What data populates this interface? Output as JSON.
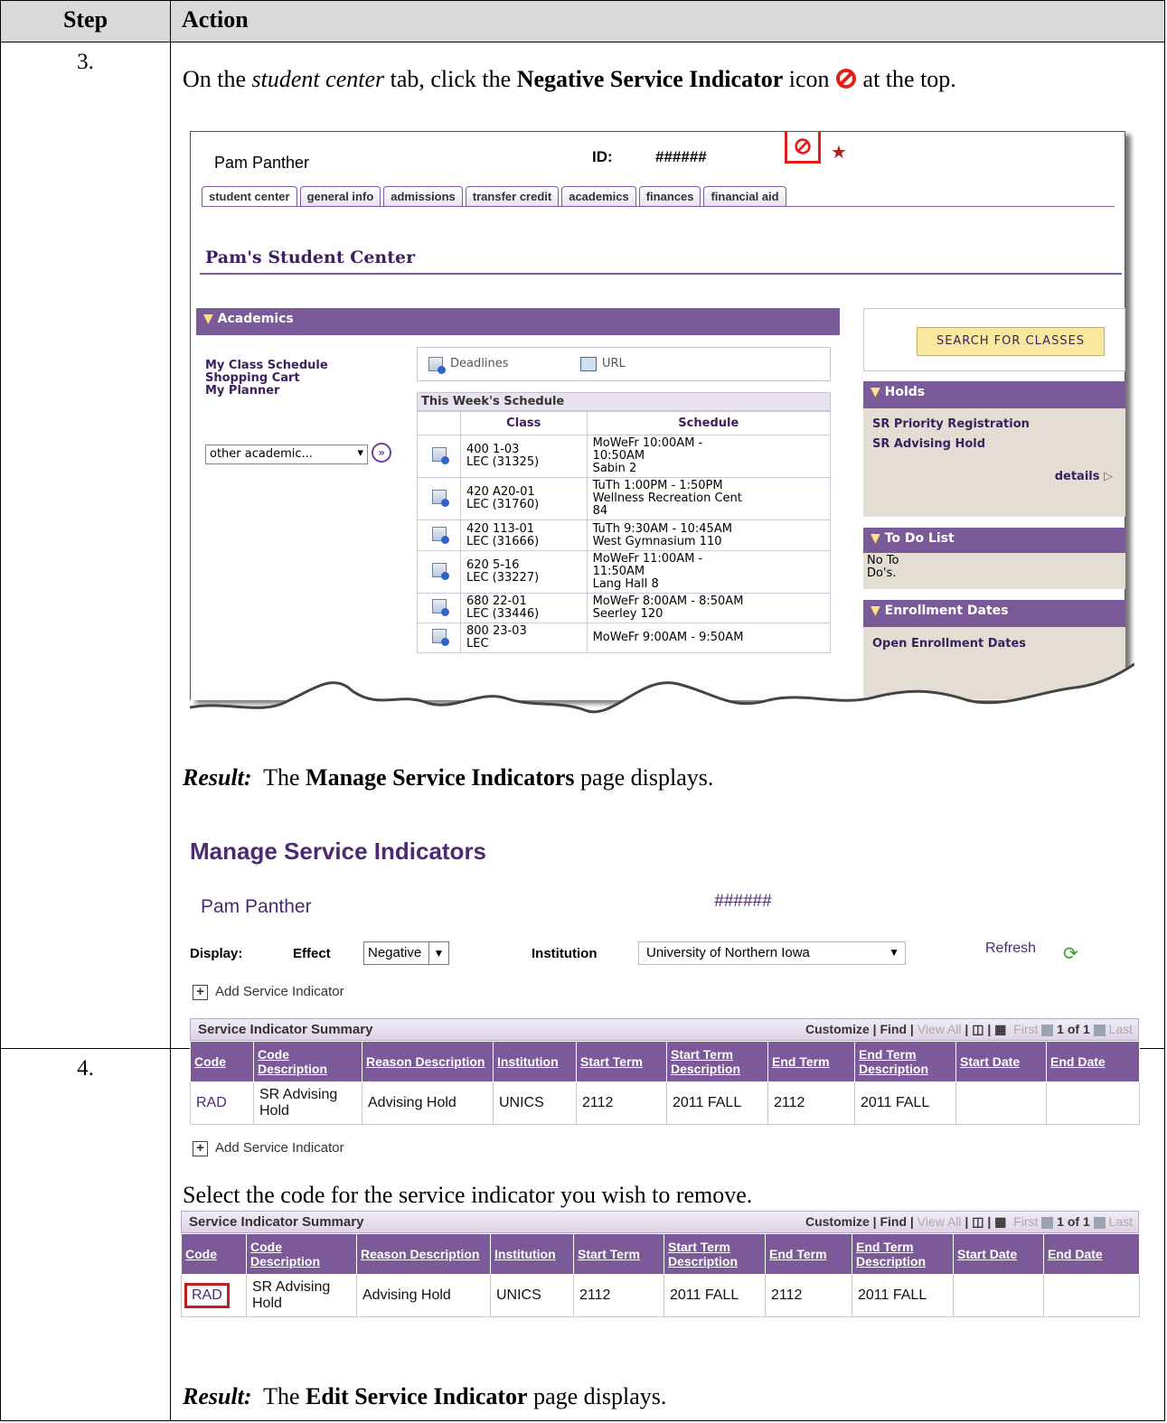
{
  "table": {
    "header_step": "Step",
    "header_action": "Action"
  },
  "step3": {
    "number": "3.",
    "instruction_1": "On the ",
    "instruction_italic": "student center",
    "instruction_2": " tab, click the ",
    "instruction_bold": "Negative Service Indicator",
    "instruction_3": " icon ",
    "instruction_4": " at the top.",
    "result_label": "Result:",
    "result_1": "  The ",
    "result_bold": "Manage Service Indicators",
    "result_2": " page displays."
  },
  "student_center": {
    "name": "Pam Panther",
    "id_label": "ID:",
    "id_value": "######",
    "tabs": [
      "student center",
      "general info",
      "admissions",
      "transfer credit",
      "academics",
      "finances",
      "financial aid"
    ],
    "page_title": "Pam's Student Center",
    "academics_header": "Academics",
    "links": [
      "My Class Schedule",
      "Shopping Cart",
      "My Planner"
    ],
    "other_academic": "other academic...",
    "deadlines": "Deadlines",
    "url": "URL",
    "schedule_title": "This Week's Schedule",
    "schedule_cols": [
      "Class",
      "Schedule"
    ],
    "schedule_rows": [
      {
        "class": "400 1-03\nLEC (31325)",
        "schedule": "MoWeFr 10:00AM -\n10:50AM\nSabin 2"
      },
      {
        "class": "420 A20-01\nLEC (31760)",
        "schedule": "TuTh 1:00PM - 1:50PM\nWellness Recreation Cent\n84"
      },
      {
        "class": "420 113-01\nLEC (31666)",
        "schedule": "TuTh 9:30AM - 10:45AM\nWest Gymnasium 110"
      },
      {
        "class": "620 5-16\nLEC (33227)",
        "schedule": "MoWeFr 11:00AM -\n11:50AM\nLang Hall 8"
      },
      {
        "class": "680 22-01\nLEC (33446)",
        "schedule": "MoWeFr 8:00AM - 8:50AM\nSeerley 120"
      },
      {
        "class": "800 23-03\nLEC",
        "schedule": "MoWeFr 9:00AM - 9:50AM"
      }
    ],
    "search_button": "SEARCH FOR CLASSES",
    "holds_header": "Holds",
    "holds": [
      "SR Priority Registration",
      "SR Advising Hold"
    ],
    "details": "details",
    "todo_header": "To Do List",
    "todo_text": "No To\nDo's.",
    "enroll_header": "Enrollment Dates",
    "enroll_link": "Open Enrollment Dates"
  },
  "manage": {
    "title": "Manage Service Indicators",
    "name": "Pam Panther",
    "id_value": "######",
    "display_label": "Display:",
    "effect_label": "Effect",
    "effect_value": "Negative",
    "institution_label": "Institution",
    "institution_value": "University of Northern Iowa",
    "refresh": "Refresh",
    "add_link": "Add Service Indicator"
  },
  "summary": {
    "title": "Service Indicator Summary",
    "customize": "Customize",
    "find": "Find",
    "view_all": "View All",
    "first": "First",
    "count": "1 of 1",
    "last": "Last",
    "columns": [
      "Code",
      "Code Description",
      "Reason Description",
      "Institution",
      "Start Term",
      "Start Term Description",
      "End Term",
      "End Term Description",
      "Start Date",
      "End Date"
    ],
    "row": [
      "RAD",
      "SR Advising Hold",
      "Advising Hold",
      "UNICS",
      "2112",
      "2011 FALL",
      "2112",
      "2011 FALL",
      "",
      ""
    ]
  },
  "step4": {
    "number": "4.",
    "instruction": "Select the code for the service indicator you wish to remove.",
    "result_label": "Result:",
    "result_1": "  The ",
    "result_bold": "Edit Service Indicator",
    "result_2": " page displays."
  },
  "colors": {
    "purple": "#7b5a99",
    "highlight_red": "#e0201b"
  }
}
